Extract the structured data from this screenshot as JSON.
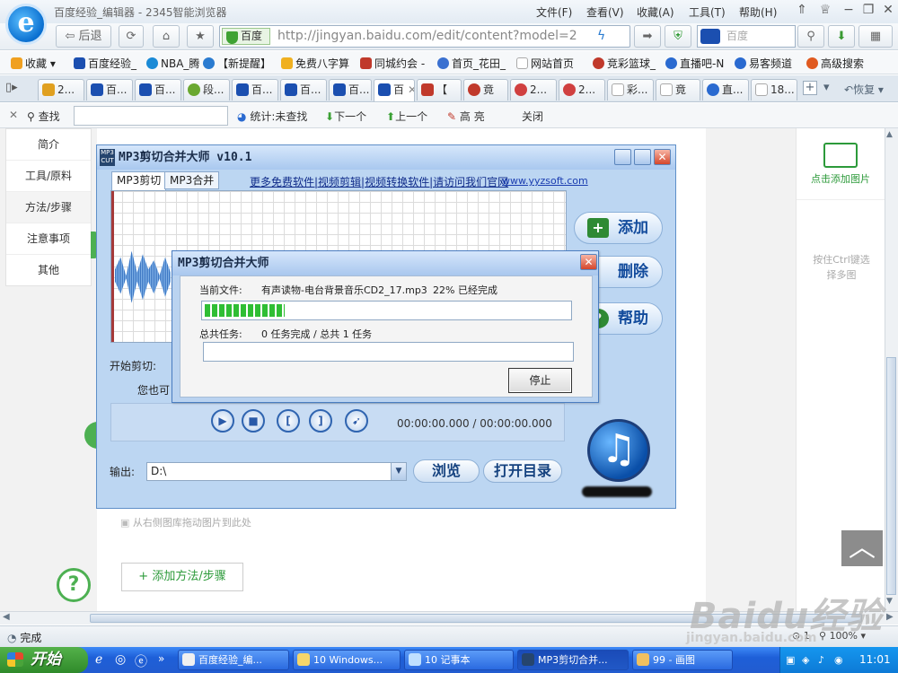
{
  "browser": {
    "title": "百度经验_编辑器 - 2345智能浏览器",
    "menu": [
      "文件(F)",
      "查看(V)",
      "收藏(A)",
      "工具(T)",
      "帮助(H)"
    ],
    "back_label": "后退",
    "address_badge": "百度",
    "url": "http://jingyan.baidu.com/edit/content?model=2",
    "search_placeholder": "百度"
  },
  "bookmarks": [
    {
      "label": "收藏",
      "color": "#f0a020"
    },
    {
      "label": "百度经验_",
      "color": "#1b4fb0"
    },
    {
      "label": "NBA_腾",
      "color": "#1a8ad6"
    },
    {
      "label": "【新提醒】",
      "color": "#2a7bd0"
    },
    {
      "label": "免费八字算",
      "color": "#f0b020"
    },
    {
      "label": "同城约会 -",
      "color": "#c0392b"
    },
    {
      "label": "首页_花田_",
      "color": "#3a70d0"
    },
    {
      "label": "网站首页",
      "color": "#aaaaaa"
    },
    {
      "label": "竞彩篮球_",
      "color": "#c0392b"
    },
    {
      "label": "直播吧-N",
      "color": "#2a6ad0"
    },
    {
      "label": "易客频道",
      "color": "#2a6ad0"
    },
    {
      "label": "高级搜索",
      "color": "#e05a20"
    }
  ],
  "tabs": [
    "2...",
    "百...",
    "百...",
    "段...",
    "百...",
    "百...",
    "百...",
    "百",
    "【",
    "竟",
    "2...",
    "2...",
    "彩...",
    "竟",
    "直...",
    "18..."
  ],
  "tabbar_restore": "恢复",
  "findbar": {
    "find_label": "查找",
    "stats_label": "统计:未查找",
    "next_label": "下一个",
    "prev_label": "上一个",
    "highlight_label": "高 亮",
    "close_label": "关闭"
  },
  "left_nav": [
    "简介",
    "工具/原料",
    "方法/步骤",
    "注意事项",
    "其他"
  ],
  "right_panel": {
    "add_image": "点击添加图片",
    "hint": "按住Ctrl键选择多图"
  },
  "mp3_window": {
    "title": "MP3剪切合并大师 v10.1",
    "tabs": [
      "MP3剪切",
      "MP3合并"
    ],
    "promo_link": "更多免费软件|视频剪辑|视频转换软件|请访问我们官网",
    "promo_url": "www.yyzsoft.com",
    "buttons": {
      "add": "添加",
      "delete": "删除",
      "help": "帮助"
    },
    "start_cut_label": "开始剪切:",
    "hint_text": "您也可",
    "time_display": "00:00:00.000 / 00:00:00.000",
    "output_label": "输出:",
    "output_path": "D:\\",
    "browse_label": "浏览",
    "open_dir_label": "打开目录"
  },
  "progress_dialog": {
    "title": "MP3剪切合并大师",
    "current_file_label": "当前文件:",
    "current_file": "有声读物-电台背景音乐CD2_17.mp3",
    "percent_text": "22% 已经完成",
    "progress": 0.22,
    "total_label": "总共任务:",
    "total_text": "0 任务完成 / 总共 1 任务",
    "stop_label": "停止"
  },
  "editor": {
    "drag_hint": "从右侧图库拖动图片到此处",
    "add_step": "+ 添加方法/步骤"
  },
  "status": {
    "text": "完成",
    "zoom": "100%"
  },
  "taskbar": {
    "start": "开始",
    "items": [
      {
        "label": "百度经验_编...",
        "active": false
      },
      {
        "label": "10 Windows...",
        "active": false
      },
      {
        "label": "10 记事本",
        "active": false
      },
      {
        "label": "MP3剪切合并...",
        "active": true
      },
      {
        "label": "99 - 画图",
        "active": false
      }
    ],
    "clock": "11:01"
  },
  "watermark": {
    "logo": "Baidu经验",
    "url": "jingyan.baidu.com"
  }
}
